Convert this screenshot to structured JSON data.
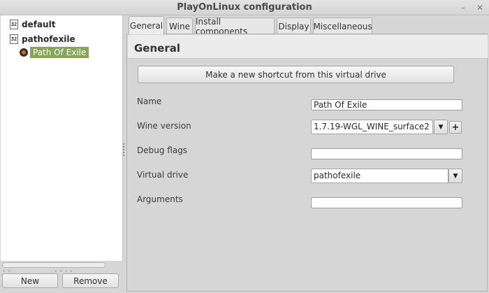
{
  "window": {
    "title": "PlayOnLinux configuration",
    "minimize_glyph": "–",
    "close_glyph": "✕"
  },
  "tree": {
    "items": [
      {
        "icon": "32",
        "label": "default"
      },
      {
        "icon": "32",
        "label": "pathofexile"
      },
      {
        "icon": "game-icon",
        "label": "Path Of Exile",
        "selected": true
      }
    ]
  },
  "left_buttons": {
    "new_label": "New",
    "remove_label": "Remove"
  },
  "tabs": [
    {
      "label": "General",
      "active": true
    },
    {
      "label": "Wine"
    },
    {
      "label": "Install components"
    },
    {
      "label": "Display"
    },
    {
      "label": "Miscellaneous"
    }
  ],
  "general": {
    "heading": "General",
    "shortcut_button": "Make a new shortcut from this virtual drive",
    "fields": {
      "name": {
        "label": "Name",
        "value": "Path Of Exile"
      },
      "wine_version": {
        "label": "Wine version",
        "value": "1.7.19-WGL_WINE_surface2"
      },
      "debug_flags": {
        "label": "Debug flags",
        "value": ""
      },
      "virtual_drive": {
        "label": "Virtual drive",
        "value": "pathofexile"
      },
      "arguments": {
        "label": "Arguments",
        "value": ""
      }
    }
  },
  "colors": {
    "selection": "#87a556",
    "window_bg": "#d6d6d6"
  }
}
